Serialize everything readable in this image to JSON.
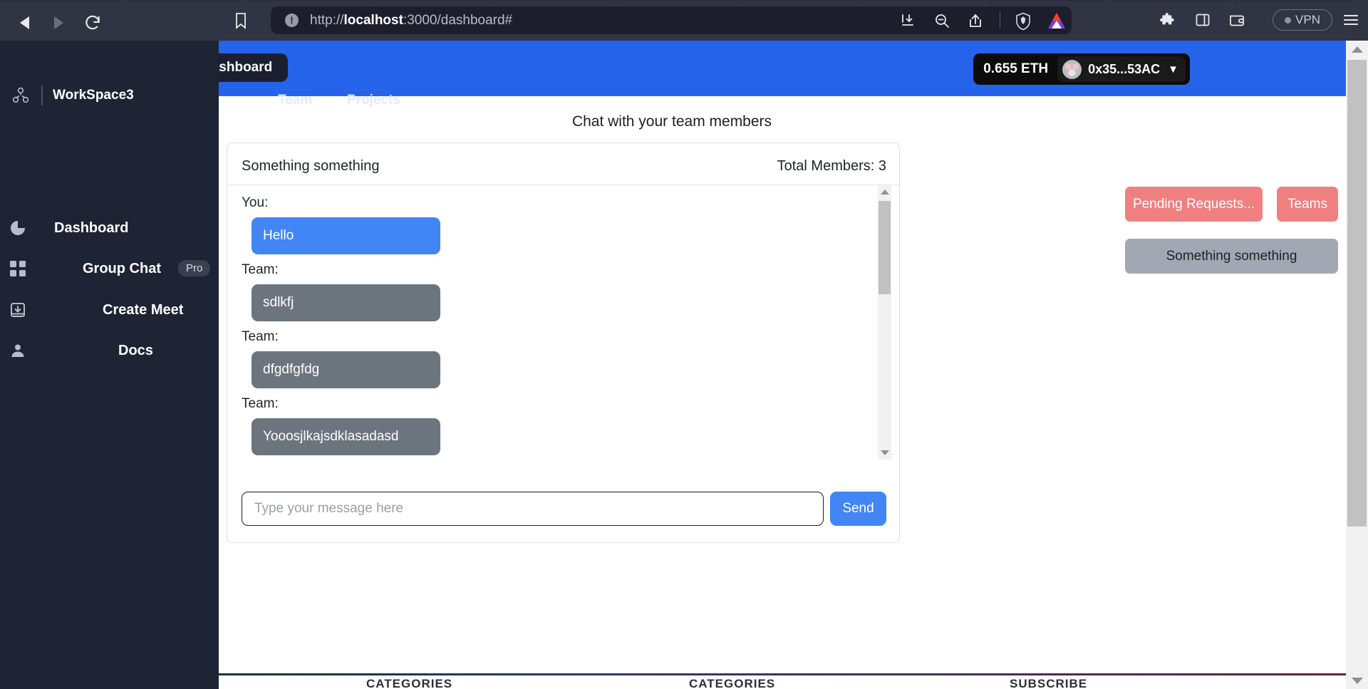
{
  "browser": {
    "name": "brave-browser",
    "nav": {
      "back_icon": "back-arrow-icon",
      "forward_icon": "forward-arrow-icon",
      "reload_icon": "reload-icon",
      "reload_glyph": "⟳",
      "bookmark_icon": "bookmark-icon"
    },
    "url": {
      "info_glyph": "!",
      "prefix": "http://",
      "host_bold": "localhost",
      "suffix": ":3000/dashboard#",
      "full": "http://localhost:3000/dashboard#"
    },
    "urlbar_icons": [
      "download-icon",
      "zoom-out-icon",
      "share-icon",
      "brave-shield-icon",
      "bat-token-icon"
    ],
    "toolbar_icons": [
      "extensions-puzzle-icon",
      "side-panel-icon",
      "wallet-icon"
    ],
    "vpn": {
      "label": "VPN",
      "status_dot_color": "#8d91a2"
    },
    "menu_icon": "hamburger-menu-icon"
  },
  "sidebar": {
    "workspace": {
      "name": "WorkSpace3",
      "icon": "workspace-network-icon"
    },
    "items": [
      {
        "label": "Dashboard",
        "icon": "pie-chart-icon",
        "badge": null
      },
      {
        "label": "Group Chat",
        "icon": "grid-squares-icon",
        "badge": "Pro"
      },
      {
        "label": "Create Meet",
        "icon": "inbox-download-icon",
        "badge": null
      },
      {
        "label": "Docs",
        "icon": "user-person-icon",
        "badge": null
      }
    ]
  },
  "appnav": {
    "tabs": [
      {
        "label": "Dashboard",
        "active": true
      },
      {
        "label": "Team",
        "active": false
      },
      {
        "label": "Projects",
        "active": false
      }
    ],
    "wallet": {
      "balance": "0.655 ETH",
      "address": "0x35...53AC",
      "avatar_icon": "mouse-avatar-icon",
      "chevron_icon": "chevron-down-icon"
    },
    "accent_color": "#2563eb"
  },
  "main": {
    "page_heading": "Chat with your team members",
    "chat": {
      "room_name": "Something something",
      "members_label": "Total Members: 3",
      "messages": [
        {
          "author": "You:",
          "text": "Hello",
          "side": "me"
        },
        {
          "author": "Team:",
          "text": "sdlkfj",
          "side": "them"
        },
        {
          "author": "Team:",
          "text": "dfgdfgfdg",
          "side": "them"
        },
        {
          "author": "Team:",
          "text": "Yooosjlkajsdklasadasd",
          "side": "them"
        }
      ],
      "composer": {
        "placeholder": "Type your message here",
        "value": "",
        "send_label": "Send"
      },
      "bubble_colors": {
        "me": "#4285f4",
        "them": "#6c757d"
      }
    },
    "right_panel": {
      "pending_requests_label": "Pending Requests...",
      "teams_label": "Teams",
      "team_item_label": "Something something",
      "button_color": "#f08080",
      "team_item_color": "#a2a8b3"
    }
  },
  "footer": {
    "columns": [
      "CATEGORIES",
      "CATEGORIES",
      "SUBSCRIBE"
    ]
  },
  "scrollbars": {
    "page": {
      "up_icon": "scroll-up-arrow-icon",
      "down_icon": "scroll-down-arrow-icon"
    },
    "chat": {
      "up_icon": "scroll-up-arrow-icon",
      "down_icon": "scroll-down-arrow-icon"
    }
  }
}
